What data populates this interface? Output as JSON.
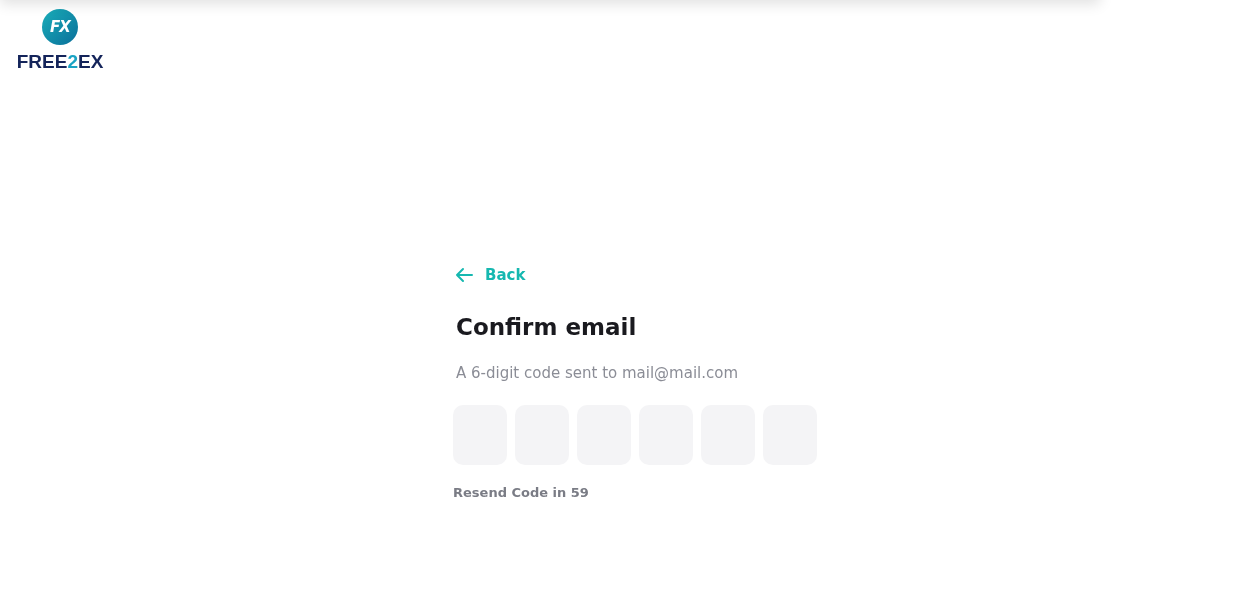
{
  "logo": {
    "mark": "FX",
    "name_start": "FREE",
    "name_accent": "2",
    "name_end": "EX"
  },
  "back": {
    "label": "Back"
  },
  "title": "Confirm email",
  "subtitle": "A 6-digit code sent to mail@mail.com",
  "code_boxes": [
    {
      "filled": false
    },
    {
      "filled": false
    },
    {
      "filled": false
    },
    {
      "filled": false
    },
    {
      "filled": false
    },
    {
      "filled": false
    }
  ],
  "resend": "Resend Code in 59"
}
